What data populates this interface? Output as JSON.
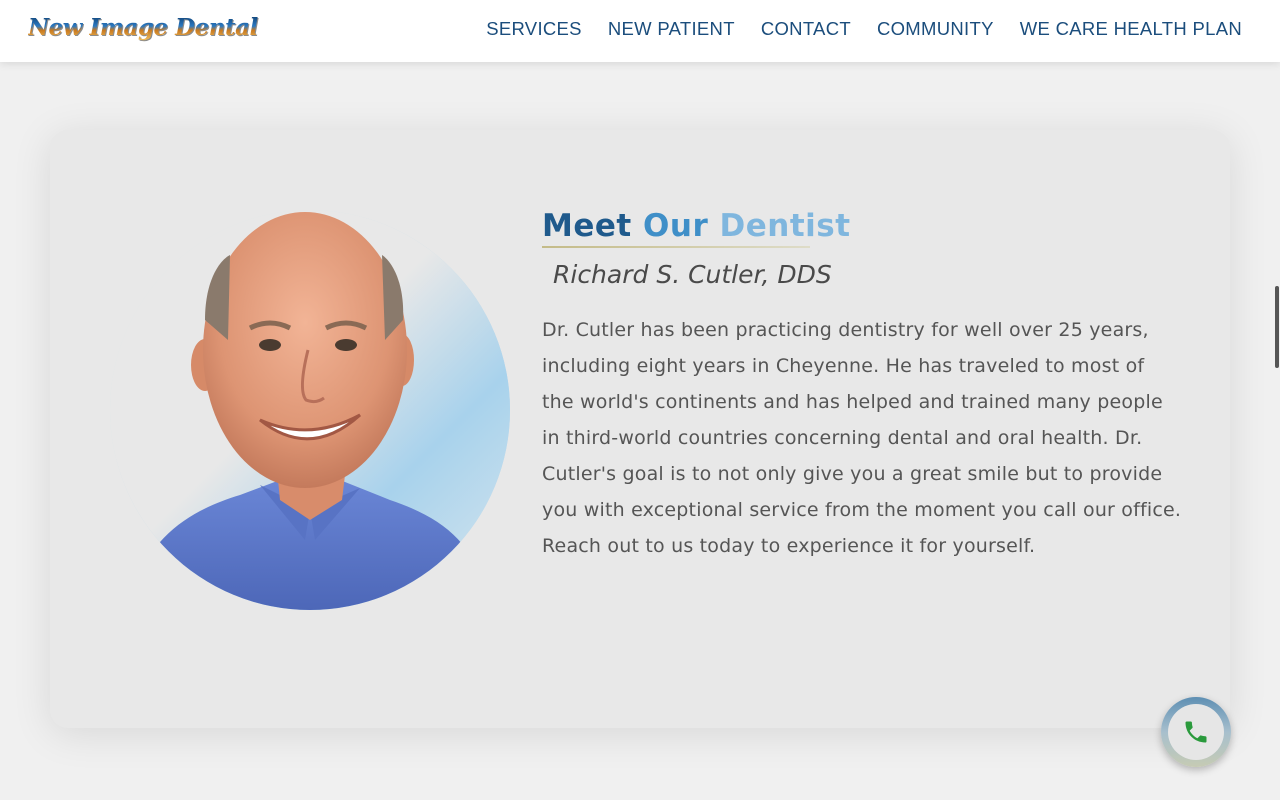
{
  "header": {
    "logo_text": "New Image Dental",
    "nav": [
      {
        "label": "SERVICES"
      },
      {
        "label": "NEW PATIENT"
      },
      {
        "label": "CONTACT"
      },
      {
        "label": "COMMUNITY"
      },
      {
        "label": "WE CARE HEALTH PLAN"
      }
    ]
  },
  "main": {
    "headline": {
      "word1": "Meet",
      "word2": "Our",
      "word3": "Dentist"
    },
    "subtitle": "Richard S. Cutler, DDS",
    "bio": "Dr. Cutler has been practicing dentistry for well over 25 years, including eight years in Cheyenne. He has traveled to most of the world's continents and has helped and trained many people in third-world countries concerning dental and oral health. Dr. Cutler's goal is to not only give you a great smile but to provide you with exceptional service from the moment you call our office. Reach out to us today to experience it for yourself."
  },
  "floating": {
    "phone_icon": "phone-icon"
  },
  "colors": {
    "nav_text": "#1b4d7c",
    "headline_1": "#1f5a8c",
    "headline_2": "#3f8fc8",
    "headline_3": "#7fb6de",
    "phone_green": "#2a9a3c"
  }
}
